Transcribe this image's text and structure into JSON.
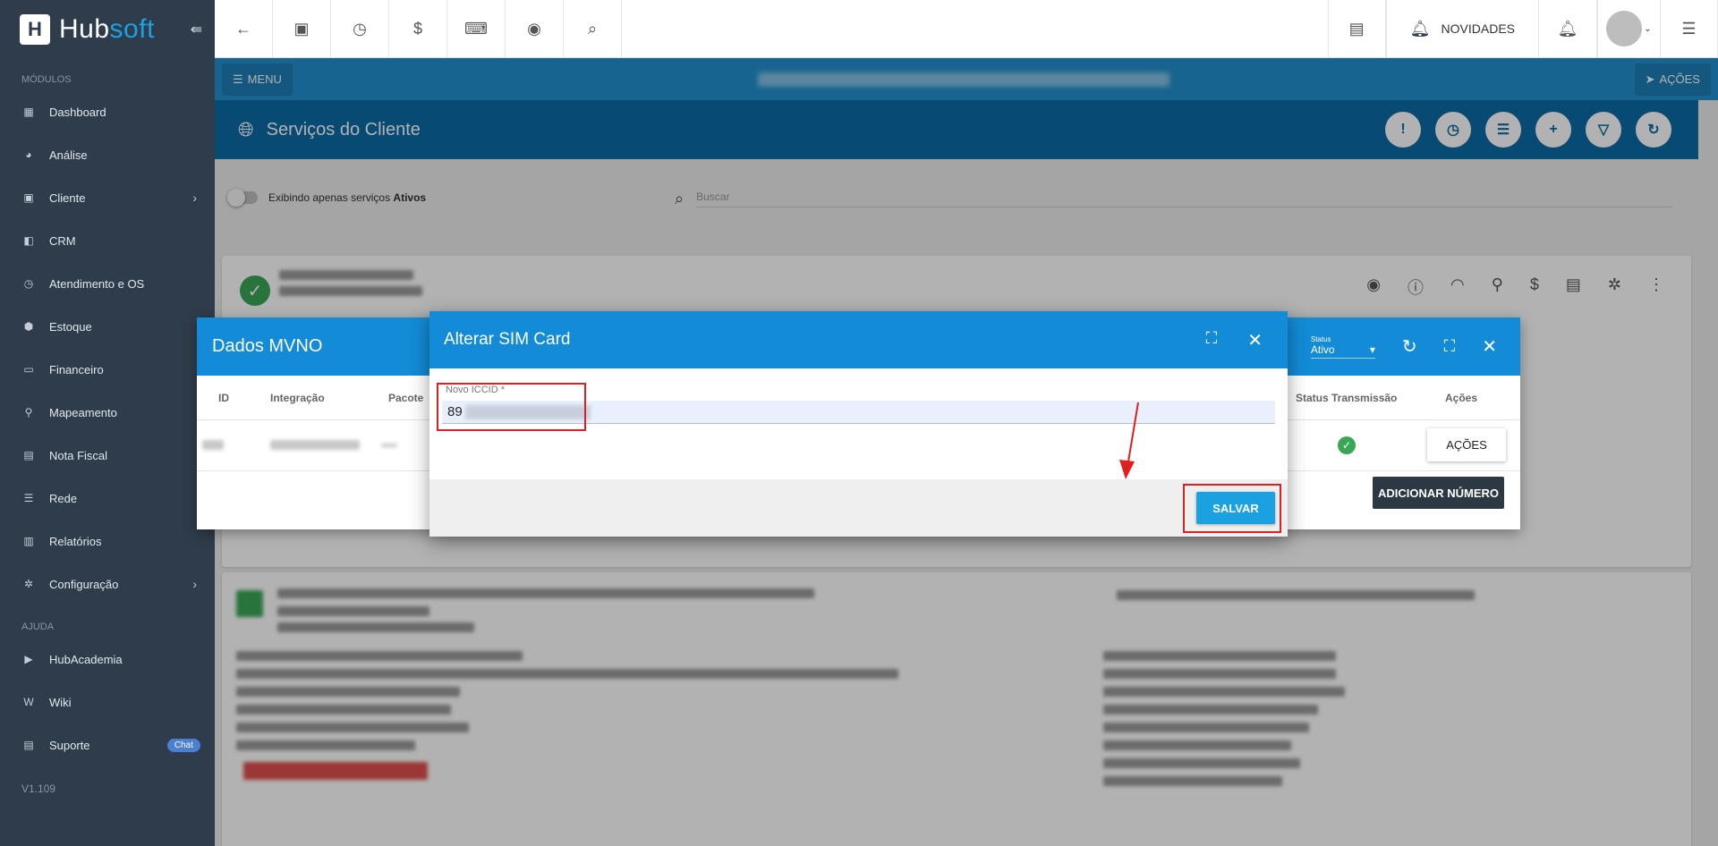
{
  "sidebar": {
    "logo_hub": "Hub",
    "logo_soft": "soft",
    "section_modulos": "MÓDULOS",
    "items": [
      {
        "label": "Dashboard",
        "icon": "dashboard-icon"
      },
      {
        "label": "Análise",
        "icon": "chart-pie-icon"
      },
      {
        "label": "Cliente",
        "icon": "contact-card-icon",
        "has_submenu": true
      },
      {
        "label": "CRM",
        "icon": "crm-icon"
      },
      {
        "label": "Atendimento e OS",
        "icon": "calendar-clock-icon"
      },
      {
        "label": "Estoque",
        "icon": "box-icon"
      },
      {
        "label": "Financeiro",
        "icon": "money-icon"
      },
      {
        "label": "Mapeamento",
        "icon": "map-pin-icon"
      },
      {
        "label": "Nota Fiscal",
        "icon": "receipt-icon"
      },
      {
        "label": "Rede",
        "icon": "server-icon"
      },
      {
        "label": "Relatórios",
        "icon": "report-icon"
      },
      {
        "label": "Configuração",
        "icon": "gear-icon",
        "has_submenu": true
      }
    ],
    "section_ajuda": "AJUDA",
    "help_items": [
      {
        "label": "HubAcademia",
        "icon": "youtube-icon"
      },
      {
        "label": "Wiki",
        "icon": "wiki-icon"
      },
      {
        "label": "Suporte",
        "icon": "chat-icon",
        "badge": "Chat"
      }
    ],
    "version": "V1.109"
  },
  "topbar": {
    "novidades": "NOVIDADES"
  },
  "menubar": {
    "menu_label": "MENU",
    "acoes_label": "AÇÕES"
  },
  "page": {
    "title": "Serviços do Cliente",
    "filter_text": "Exibindo apenas serviços",
    "filter_bold": "Ativos",
    "search_placeholder": "Buscar"
  },
  "mvno_dialog": {
    "title": "Dados MVNO",
    "status_label": "Status",
    "status_value": "Ativo",
    "columns": {
      "id": "ID",
      "integracao": "Integração",
      "pacote": "Pacote",
      "status_transmissao": "Status Transmissão",
      "acoes": "Ações"
    },
    "row_action": "AÇÕES",
    "add_button": "ADICIONAR NÚMERO"
  },
  "sim_dialog": {
    "title": "Alterar SIM Card",
    "field_label": "Novo ICCID *",
    "field_value": "89",
    "save_button": "SALVAR"
  },
  "colors": {
    "sidebar_bg": "#2f3c4b",
    "primary_blue": "#138bd6",
    "header_blue": "#0b6aa5",
    "accent_green": "#3aa757",
    "highlight_red": "#e02020"
  }
}
